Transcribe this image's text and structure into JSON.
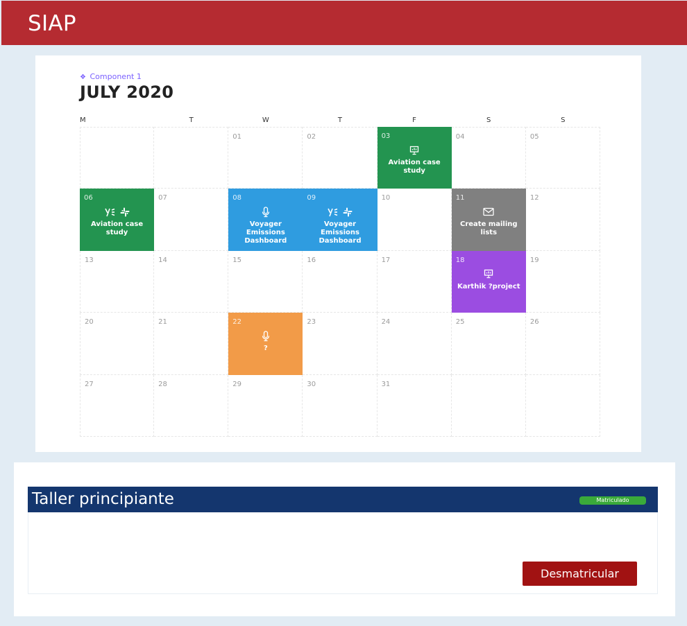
{
  "app": {
    "title": "SIAP"
  },
  "calendar": {
    "component_label": "Component 1",
    "month_title": "JULY 2020",
    "weekdays": [
      "M",
      "T",
      "W",
      "T",
      "F",
      "S",
      "S"
    ],
    "cells": [
      {
        "day": ""
      },
      {
        "day": ""
      },
      {
        "day": "01"
      },
      {
        "day": "02"
      },
      {
        "day": "03",
        "event": {
          "title": "Aviation case study",
          "color": "#239450",
          "icons": [
            "presentation-icon"
          ]
        }
      },
      {
        "day": "04"
      },
      {
        "day": "05"
      },
      {
        "day": "06",
        "event": {
          "title": "Aviation case study",
          "color": "#239450",
          "icons": [
            "yammer-icon",
            "slack-icon"
          ]
        }
      },
      {
        "day": "07"
      },
      {
        "day": "08",
        "event": {
          "title": "Voyager Emissions Dashboard",
          "color": "#2f9ce0",
          "icons": [
            "microphone-icon"
          ]
        }
      },
      {
        "day": "09",
        "event": {
          "title": "Voyager Emissions Dashboard",
          "color": "#2f9ce0",
          "icons": [
            "yammer-icon",
            "slack-icon"
          ]
        }
      },
      {
        "day": "10"
      },
      {
        "day": "11",
        "event": {
          "title": "Create mailing lists",
          "color": "#808080",
          "icons": [
            "mail-icon"
          ]
        }
      },
      {
        "day": "12"
      },
      {
        "day": "13"
      },
      {
        "day": "14"
      },
      {
        "day": "15"
      },
      {
        "day": "16"
      },
      {
        "day": "17"
      },
      {
        "day": "18",
        "event": {
          "title": "Karthik ?project",
          "color": "#9b4de1",
          "icons": [
            "presentation-icon"
          ]
        }
      },
      {
        "day": "19"
      },
      {
        "day": "20"
      },
      {
        "day": "21"
      },
      {
        "day": "22",
        "event": {
          "title": "?",
          "color": "#f29b48",
          "icons": [
            "microphone-icon"
          ]
        }
      },
      {
        "day": "23"
      },
      {
        "day": "24"
      },
      {
        "day": "25"
      },
      {
        "day": "26"
      },
      {
        "day": "27"
      },
      {
        "day": "28"
      },
      {
        "day": "29"
      },
      {
        "day": "30"
      },
      {
        "day": "31"
      },
      {
        "day": ""
      },
      {
        "day": ""
      }
    ]
  },
  "course": {
    "title": "Taller principiante",
    "status_badge": "Matriculado",
    "status_color": "#3aaa3a",
    "unenroll_label": "Desmatricular"
  }
}
